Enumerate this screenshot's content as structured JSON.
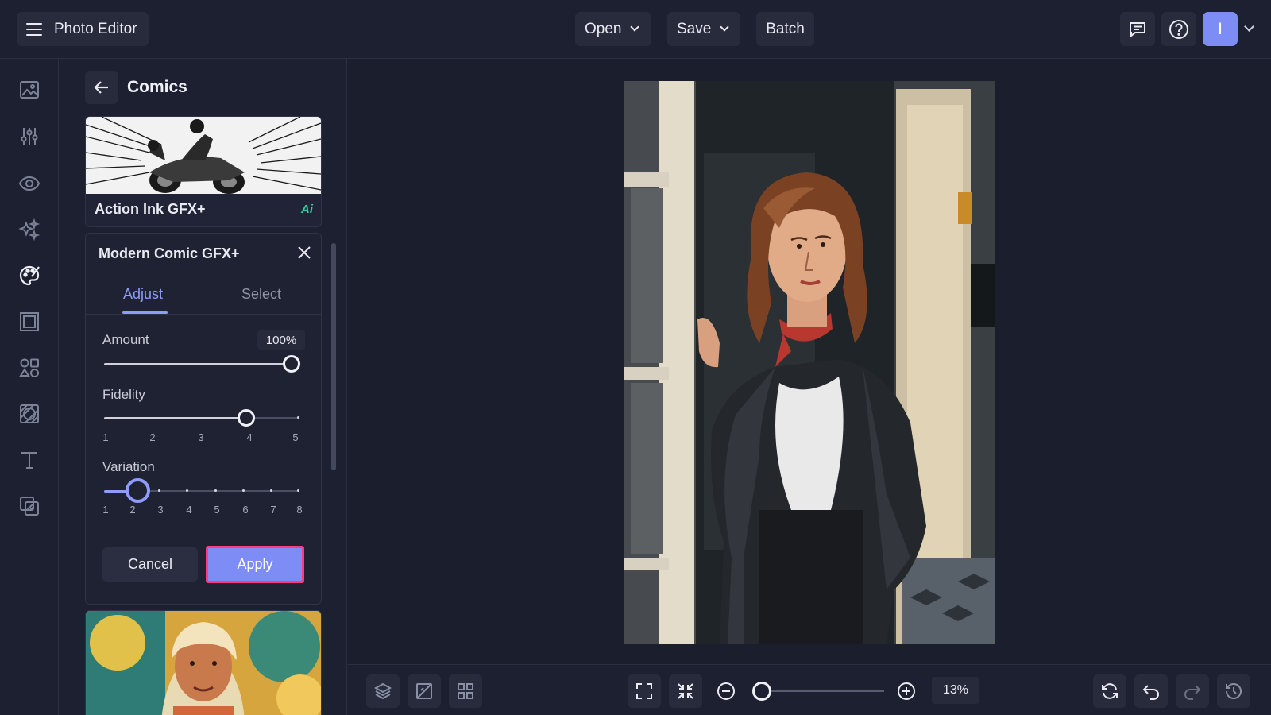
{
  "app": {
    "title": "Photo Editor"
  },
  "toolbar": {
    "open_label": "Open",
    "save_label": "Save",
    "batch_label": "Batch",
    "avatar_initial": "I"
  },
  "sidebar_icons": [
    "image-icon",
    "sliders-icon",
    "eye-icon",
    "sparkles-icon",
    "palette-icon",
    "frame-icon",
    "shapes-icon",
    "texture-icon",
    "text-icon",
    "overlay-icon"
  ],
  "panel": {
    "title": "Comics",
    "presets": [
      {
        "label": "Action Ink GFX+",
        "badge": "Ai"
      }
    ],
    "editor": {
      "title": "Modern Comic GFX+",
      "tabs": {
        "adjust": "Adjust",
        "select": "Select"
      },
      "amount": {
        "label": "Amount",
        "value": "100%",
        "level": 1.0
      },
      "fidelity": {
        "label": "Fidelity",
        "ticks": [
          "1",
          "2",
          "3",
          "4",
          "5"
        ],
        "selected": 4
      },
      "variation": {
        "label": "Variation",
        "ticks": [
          "1",
          "2",
          "3",
          "4",
          "5",
          "6",
          "7",
          "8"
        ],
        "selected": 2
      },
      "cancel_label": "Cancel",
      "apply_label": "Apply"
    }
  },
  "zoom": {
    "value": "13%",
    "level": 0.0
  },
  "colors": {
    "accent": "#7e8cf6",
    "highlight_border": "#ff3a7e",
    "ai_badge": "#34d2a4",
    "background": "#1b1e2c"
  }
}
